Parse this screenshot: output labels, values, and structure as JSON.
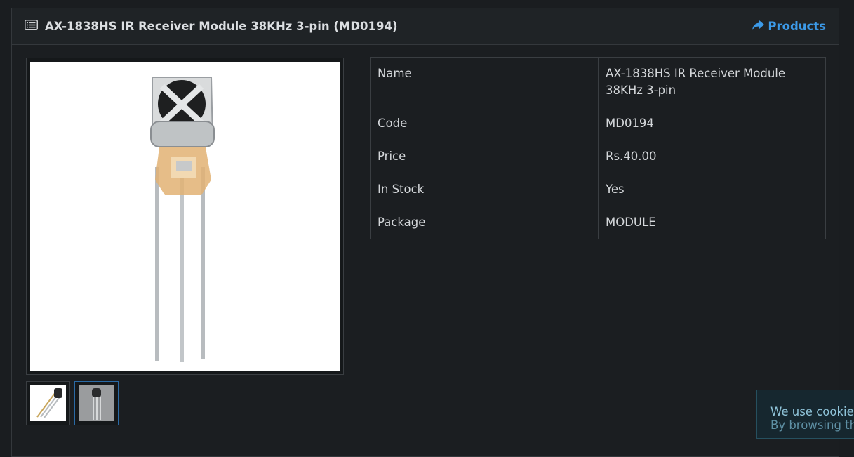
{
  "header": {
    "title": "AX-1838HS IR Receiver Module 38KHz 3-pin (MD0194)",
    "products_link": "Products",
    "accent_color": "#3c9ae8"
  },
  "product_table": [
    {
      "label": "Name",
      "value": "AX-1838HS IR Receiver Module 38KHz 3-pin"
    },
    {
      "label": "Code",
      "value": "MD0194"
    },
    {
      "label": "Price",
      "value": "Rs.40.00"
    },
    {
      "label": "In Stock",
      "value": "Yes"
    },
    {
      "label": "Package",
      "value": "MODULE"
    }
  ],
  "cookie_banner": {
    "line1": "We use cookies",
    "line2": "By browsing th"
  }
}
